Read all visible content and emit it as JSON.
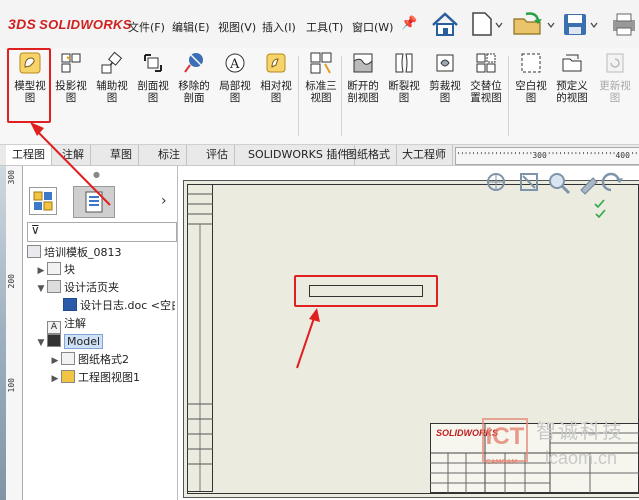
{
  "app": {
    "logo_text": "SOLIDWORKS",
    "logo_ds": "3DS"
  },
  "menu": [
    {
      "label": "文件(F)"
    },
    {
      "label": "编辑(E)"
    },
    {
      "label": "视图(V)"
    },
    {
      "label": "插入(I)"
    },
    {
      "label": "工具(T)"
    },
    {
      "label": "窗口(W)"
    }
  ],
  "ribbon": [
    {
      "line1": "模型视",
      "line2": "图",
      "icon": "model-view-icon",
      "enabled": true
    },
    {
      "line1": "投影视",
      "line2": "图",
      "icon": "projected-view-icon",
      "enabled": true
    },
    {
      "line1": "辅助视",
      "line2": "图",
      "icon": "auxiliary-view-icon",
      "enabled": true
    },
    {
      "line1": "剖面视",
      "line2": "图",
      "icon": "section-view-icon",
      "enabled": true
    },
    {
      "line1": "移除的",
      "line2": "剖面",
      "icon": "removed-section-icon",
      "enabled": true
    },
    {
      "line1": "局部视",
      "line2": "图",
      "icon": "detail-view-icon",
      "enabled": true
    },
    {
      "line1": "相对视",
      "line2": "图",
      "icon": "relative-view-icon",
      "enabled": true
    },
    {
      "line1": "标准三",
      "line2": "视图",
      "icon": "standard-3-view-icon",
      "enabled": true
    },
    {
      "line1": "断开的",
      "line2": "剖视图",
      "icon": "broken-out-section-icon",
      "enabled": true
    },
    {
      "line1": "断裂视",
      "line2": "图",
      "icon": "break-view-icon",
      "enabled": true
    },
    {
      "line1": "剪裁视",
      "line2": "图",
      "icon": "crop-view-icon",
      "enabled": true
    },
    {
      "line1": "交替位",
      "line2": "置视图",
      "icon": "alternate-position-icon",
      "enabled": true
    },
    {
      "line1": "空白视",
      "line2": "图",
      "icon": "empty-view-icon",
      "enabled": true
    },
    {
      "line1": "预定义",
      "line2": "的视图",
      "icon": "predefined-view-icon",
      "enabled": true
    },
    {
      "line1": "更新视",
      "line2": "图",
      "icon": "update-view-icon",
      "enabled": false
    }
  ],
  "tabs": [
    {
      "label": "工程图",
      "active": true
    },
    {
      "label": "注解"
    },
    {
      "label": "草图"
    },
    {
      "label": "标注"
    },
    {
      "label": "评估"
    },
    {
      "label": "SOLIDWORKS 插件"
    },
    {
      "label": "图纸格式"
    },
    {
      "label": "大工程师"
    }
  ],
  "ruler_h": {
    "label_300": "300",
    "label_400": "400"
  },
  "ruler_v": {
    "label_300": "300",
    "label_200": "200",
    "label_100": "100"
  },
  "tree": {
    "root": "培训模板_0813",
    "items": [
      {
        "label": "块",
        "level": 1,
        "expander": "▶"
      },
      {
        "label": "设计活页夹",
        "level": 1,
        "expander": "▼"
      },
      {
        "label": "设计日志.doc <空白",
        "level": 2,
        "expander": ""
      },
      {
        "label": "注解",
        "level": 1,
        "expander": ""
      },
      {
        "label": "Model",
        "level": 1,
        "expander": "▼",
        "selected": true
      },
      {
        "label": "图纸格式2",
        "level": 2,
        "expander": "▶"
      },
      {
        "label": "工程图视图1",
        "level": 2,
        "expander": "▶"
      }
    ]
  },
  "titleblock": {
    "company_logo": "SOLIDWORKS"
  },
  "watermark": {
    "brand": "ICT",
    "sub": "CAMCAM",
    "text_cn": "智诚科技",
    "url": "icaom.cn"
  },
  "colors": {
    "highlight": "#e02020",
    "accent": "#1a66c4",
    "logo": "#d02020"
  }
}
